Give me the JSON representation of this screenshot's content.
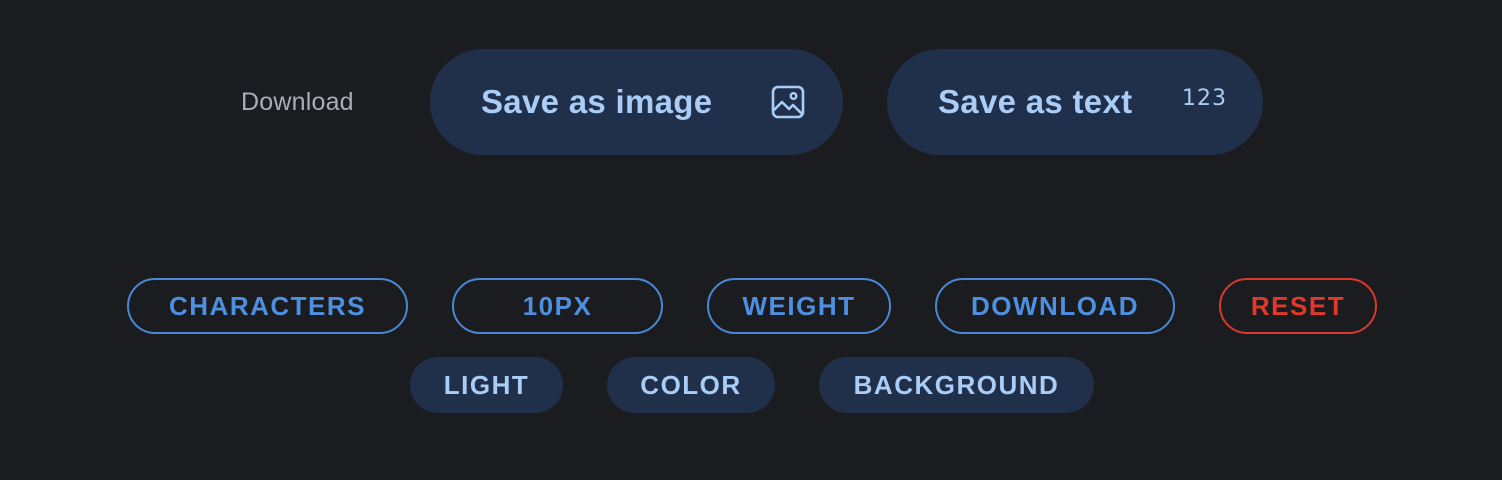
{
  "download": {
    "label": "Download",
    "save_image_label": "Save as image",
    "save_image_icon": "image-icon",
    "save_text_label": "Save as text",
    "save_text_icon": "123",
    "save_text_icon_name": "numbers-icon"
  },
  "options": {
    "row1": [
      "CHARACTERS",
      "10PX",
      "WEIGHT",
      "DOWNLOAD",
      "RESET"
    ],
    "row2": [
      "LIGHT",
      "COLOR",
      "BACKGROUND"
    ]
  },
  "colors": {
    "background": "#1b1c20",
    "button_fill": "#21304a",
    "button_text": "#a9cdf7",
    "chip_outline": "#4a88d6",
    "danger": "#e2382b"
  }
}
